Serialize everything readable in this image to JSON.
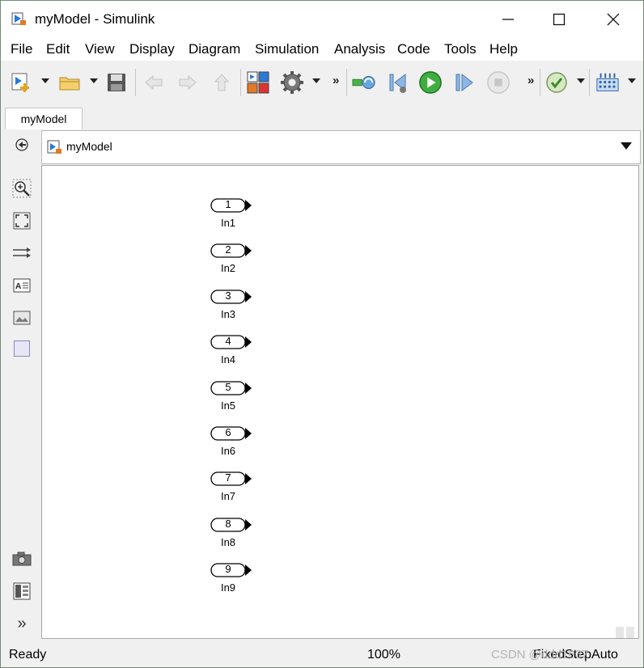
{
  "window": {
    "title": "myModel - Simulink"
  },
  "menu": [
    "File",
    "Edit",
    "View",
    "Display",
    "Diagram",
    "Simulation",
    "Analysis",
    "Code",
    "Tools",
    "Help"
  ],
  "tab": {
    "label": "myModel"
  },
  "address": {
    "path": "myModel"
  },
  "canvas": {
    "blocks": [
      {
        "number": "1",
        "label": "In1"
      },
      {
        "number": "2",
        "label": "In2"
      },
      {
        "number": "3",
        "label": "In3"
      },
      {
        "number": "4",
        "label": "In4"
      },
      {
        "number": "5",
        "label": "In5"
      },
      {
        "number": "6",
        "label": "In6"
      },
      {
        "number": "7",
        "label": "In7"
      },
      {
        "number": "8",
        "label": "In8"
      },
      {
        "number": "9",
        "label": "In9"
      }
    ]
  },
  "status": {
    "state": "Ready",
    "zoom": "100%",
    "solver": "FixedStepAuto",
    "watermark": "CSDN @ddd1637"
  },
  "colors": {
    "accent": "#2a7ad6",
    "run_green": "#3fae3f",
    "toolbar_bg": "#f0f0f0"
  },
  "toolbar_icons": [
    "new-model-icon",
    "open-icon",
    "save-icon",
    "back-icon",
    "forward-icon",
    "up-icon",
    "library-browser-icon",
    "model-config-icon",
    "step-back-icon",
    "run-icon",
    "step-forward-icon",
    "stop-icon",
    "check-icon",
    "data-inspector-icon"
  ]
}
